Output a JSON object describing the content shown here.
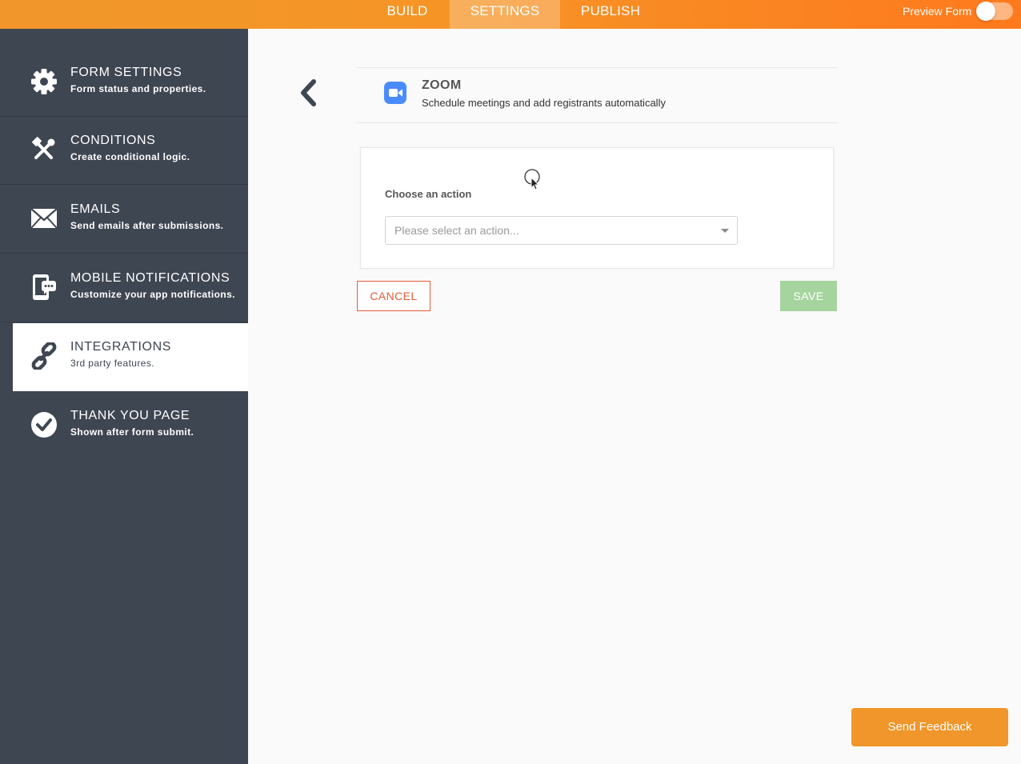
{
  "topbar": {
    "tabs": [
      {
        "label": "BUILD",
        "active": false
      },
      {
        "label": "SETTINGS",
        "active": true
      },
      {
        "label": "PUBLISH",
        "active": false
      }
    ],
    "preview_label": "Preview Form",
    "preview_enabled": false
  },
  "sidebar": {
    "items": [
      {
        "title": "FORM SETTINGS",
        "subtitle": "Form status and properties.",
        "icon": "gear-icon"
      },
      {
        "title": "CONDITIONS",
        "subtitle": "Create conditional logic.",
        "icon": "tools-icon"
      },
      {
        "title": "EMAILS",
        "subtitle": "Send emails after submissions.",
        "icon": "envelope-icon"
      },
      {
        "title": "MOBILE NOTIFICATIONS",
        "subtitle": "Customize your app notifications.",
        "icon": "mobile-notification-icon"
      },
      {
        "title": "INTEGRATIONS",
        "subtitle": "3rd party features.",
        "icon": "link-icon",
        "active": true
      },
      {
        "title": "THANK YOU PAGE",
        "subtitle": "Shown after form submit.",
        "icon": "check-circle-icon"
      }
    ]
  },
  "integration": {
    "name": "ZOOM",
    "description": "Schedule meetings and add registrants automatically",
    "logo_icon": "zoom-camera-icon"
  },
  "action": {
    "label": "Choose an action",
    "placeholder": "Please select an action..."
  },
  "buttons": {
    "cancel": "CANCEL",
    "save": "SAVE",
    "feedback": "Send Feedback"
  },
  "colors": {
    "topbar": "#f69526",
    "sidebar": "#3e4652",
    "cancel": "#e05d3a",
    "save": "#a6d49e",
    "feedback": "#f0962a",
    "zoom_blue": "#4a8cff"
  }
}
